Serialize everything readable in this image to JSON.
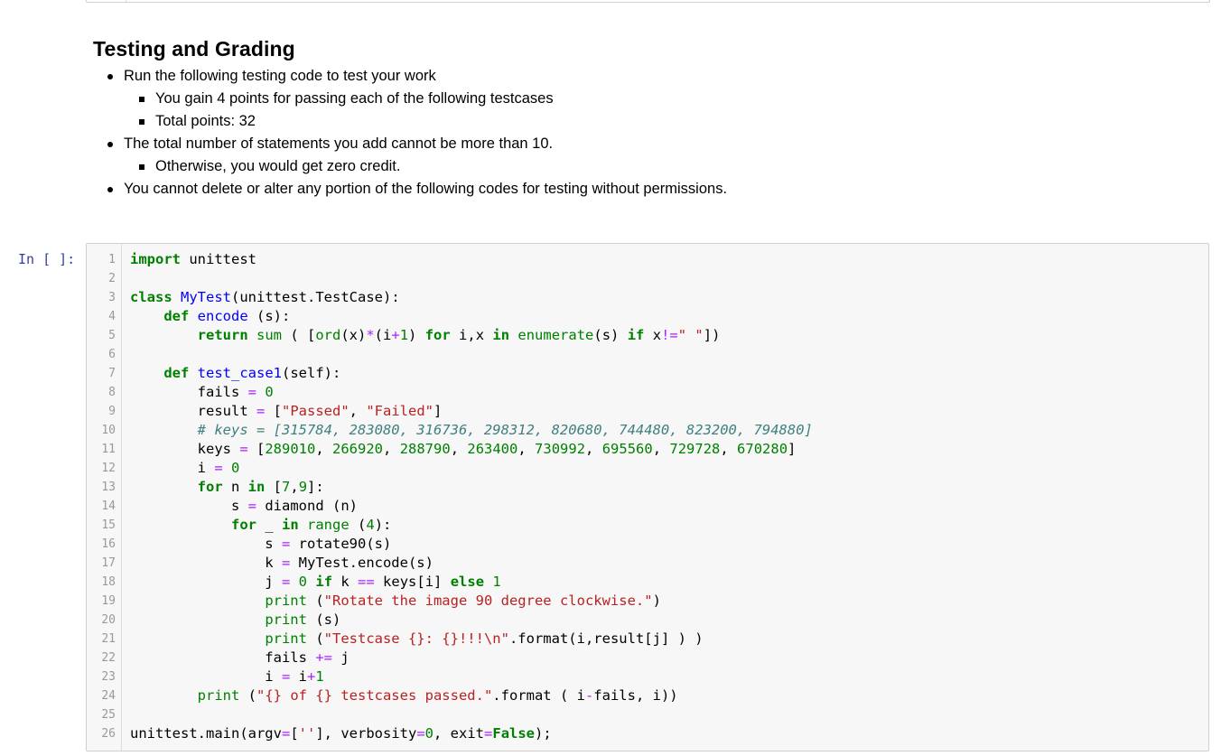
{
  "notebook": {
    "markdown_cell": {
      "heading": "Testing and Grading",
      "bullets": [
        {
          "text": "Run the following testing code to test your work",
          "sub": [
            "You gain 4 points for passing each of the following testcases",
            "Total points: 32"
          ]
        },
        {
          "text": "The total number of statements you add cannot be more than 10.",
          "sub": [
            "Otherwise, you would get zero credit."
          ]
        },
        {
          "text": "You cannot delete or alter any portion of the following codes for testing without permissions.",
          "sub": []
        }
      ]
    },
    "code_cell": {
      "prompt": "In [ ]:",
      "lines": [
        [
          [
            "kw",
            "import"
          ],
          [
            "sp",
            " unittest"
          ]
        ],
        [],
        [
          [
            "kw",
            "class"
          ],
          [
            "sp",
            " "
          ],
          [
            "def",
            "MyTest"
          ],
          [
            "sp",
            "(unittest.TestCase):"
          ]
        ],
        [
          [
            "sp",
            "    "
          ],
          [
            "kw",
            "def"
          ],
          [
            "sp",
            " "
          ],
          [
            "def",
            "encode"
          ],
          [
            "sp",
            " (s):"
          ]
        ],
        [
          [
            "sp",
            "        "
          ],
          [
            "kw",
            "return"
          ],
          [
            "sp",
            " "
          ],
          [
            "bi",
            "sum"
          ],
          [
            "sp",
            " ( ["
          ],
          [
            "bi",
            "ord"
          ],
          [
            "sp",
            "(x)"
          ],
          [
            "op",
            "*"
          ],
          [
            "sp",
            "(i"
          ],
          [
            "op",
            "+"
          ],
          [
            "num",
            "1"
          ],
          [
            "sp",
            ") "
          ],
          [
            "kw",
            "for"
          ],
          [
            "sp",
            " i,x "
          ],
          [
            "kw",
            "in"
          ],
          [
            "sp",
            " "
          ],
          [
            "bi",
            "enumerate"
          ],
          [
            "sp",
            "(s) "
          ],
          [
            "kw",
            "if"
          ],
          [
            "sp",
            " x"
          ],
          [
            "op",
            "!="
          ],
          [
            "str",
            "\" \""
          ],
          [
            "sp",
            "])"
          ]
        ],
        [],
        [
          [
            "sp",
            "    "
          ],
          [
            "kw",
            "def"
          ],
          [
            "sp",
            " "
          ],
          [
            "def",
            "test_case1"
          ],
          [
            "sp",
            "(self):"
          ]
        ],
        [
          [
            "sp",
            "        fails "
          ],
          [
            "op",
            "="
          ],
          [
            "sp",
            " "
          ],
          [
            "num",
            "0"
          ]
        ],
        [
          [
            "sp",
            "        result "
          ],
          [
            "op",
            "="
          ],
          [
            "sp",
            " ["
          ],
          [
            "str",
            "\"Passed\""
          ],
          [
            "sp",
            ", "
          ],
          [
            "str",
            "\"Failed\""
          ],
          [
            "sp",
            "]"
          ]
        ],
        [
          [
            "sp",
            "        "
          ],
          [
            "cm",
            "# keys = [315784, 283080, 316736, 298312, 820680, 744480, 823200, 794880]"
          ]
        ],
        [
          [
            "sp",
            "        keys "
          ],
          [
            "op",
            "="
          ],
          [
            "sp",
            " ["
          ],
          [
            "num",
            "289010"
          ],
          [
            "sp",
            ", "
          ],
          [
            "num",
            "266920"
          ],
          [
            "sp",
            ", "
          ],
          [
            "num",
            "288790"
          ],
          [
            "sp",
            ", "
          ],
          [
            "num",
            "263400"
          ],
          [
            "sp",
            ", "
          ],
          [
            "num",
            "730992"
          ],
          [
            "sp",
            ", "
          ],
          [
            "num",
            "695560"
          ],
          [
            "sp",
            ", "
          ],
          [
            "num",
            "729728"
          ],
          [
            "sp",
            ", "
          ],
          [
            "num",
            "670280"
          ],
          [
            "sp",
            "]"
          ]
        ],
        [
          [
            "sp",
            "        i "
          ],
          [
            "op",
            "="
          ],
          [
            "sp",
            " "
          ],
          [
            "num",
            "0"
          ]
        ],
        [
          [
            "sp",
            "        "
          ],
          [
            "kw",
            "for"
          ],
          [
            "sp",
            " n "
          ],
          [
            "kw",
            "in"
          ],
          [
            "sp",
            " ["
          ],
          [
            "num",
            "7"
          ],
          [
            "sp",
            ","
          ],
          [
            "num",
            "9"
          ],
          [
            "sp",
            "]:"
          ]
        ],
        [
          [
            "sp",
            "            s "
          ],
          [
            "op",
            "="
          ],
          [
            "sp",
            " diamond (n)"
          ]
        ],
        [
          [
            "sp",
            "            "
          ],
          [
            "kw",
            "for"
          ],
          [
            "sp",
            " _ "
          ],
          [
            "kw",
            "in"
          ],
          [
            "sp",
            " "
          ],
          [
            "bi",
            "range"
          ],
          [
            "sp",
            " ("
          ],
          [
            "num",
            "4"
          ],
          [
            "sp",
            "):"
          ]
        ],
        [
          [
            "sp",
            "                s "
          ],
          [
            "op",
            "="
          ],
          [
            "sp",
            " rotate90(s)"
          ]
        ],
        [
          [
            "sp",
            "                k "
          ],
          [
            "op",
            "="
          ],
          [
            "sp",
            " MyTest.encode(s)"
          ]
        ],
        [
          [
            "sp",
            "                j "
          ],
          [
            "op",
            "="
          ],
          [
            "sp",
            " "
          ],
          [
            "num",
            "0"
          ],
          [
            "sp",
            " "
          ],
          [
            "kw",
            "if"
          ],
          [
            "sp",
            " k "
          ],
          [
            "op",
            "=="
          ],
          [
            "sp",
            " keys[i] "
          ],
          [
            "kw",
            "else"
          ],
          [
            "sp",
            " "
          ],
          [
            "num",
            "1"
          ]
        ],
        [
          [
            "sp",
            "                "
          ],
          [
            "bi",
            "print"
          ],
          [
            "sp",
            " ("
          ],
          [
            "str",
            "\"Rotate the image 90 degree clockwise.\""
          ],
          [
            "sp",
            ")"
          ]
        ],
        [
          [
            "sp",
            "                "
          ],
          [
            "bi",
            "print"
          ],
          [
            "sp",
            " (s)"
          ]
        ],
        [
          [
            "sp",
            "                "
          ],
          [
            "bi",
            "print"
          ],
          [
            "sp",
            " ("
          ],
          [
            "str",
            "\"Testcase {}: {}!!!\\n\""
          ],
          [
            "sp",
            ".format(i,result[j] ) )"
          ]
        ],
        [
          [
            "sp",
            "                fails "
          ],
          [
            "op",
            "+="
          ],
          [
            "sp",
            " j"
          ]
        ],
        [
          [
            "sp",
            "                i "
          ],
          [
            "op",
            "="
          ],
          [
            "sp",
            " i"
          ],
          [
            "op",
            "+"
          ],
          [
            "num",
            "1"
          ]
        ],
        [
          [
            "sp",
            "        "
          ],
          [
            "bi",
            "print"
          ],
          [
            "sp",
            " ("
          ],
          [
            "str",
            "\"{} of {} testcases passed.\""
          ],
          [
            "sp",
            ".format ( i"
          ],
          [
            "op",
            "-"
          ],
          [
            "sp",
            "fails, i))"
          ]
        ],
        [],
        [
          [
            "sp",
            "unittest.main(argv"
          ],
          [
            "op",
            "="
          ],
          [
            "sp",
            "["
          ],
          [
            "str",
            "''"
          ],
          [
            "sp",
            "], verbosity"
          ],
          [
            "op",
            "="
          ],
          [
            "num",
            "0"
          ],
          [
            "sp",
            ", exit"
          ],
          [
            "op",
            "="
          ],
          [
            "kw",
            "False"
          ],
          [
            "sp",
            ");"
          ]
        ]
      ]
    }
  }
}
